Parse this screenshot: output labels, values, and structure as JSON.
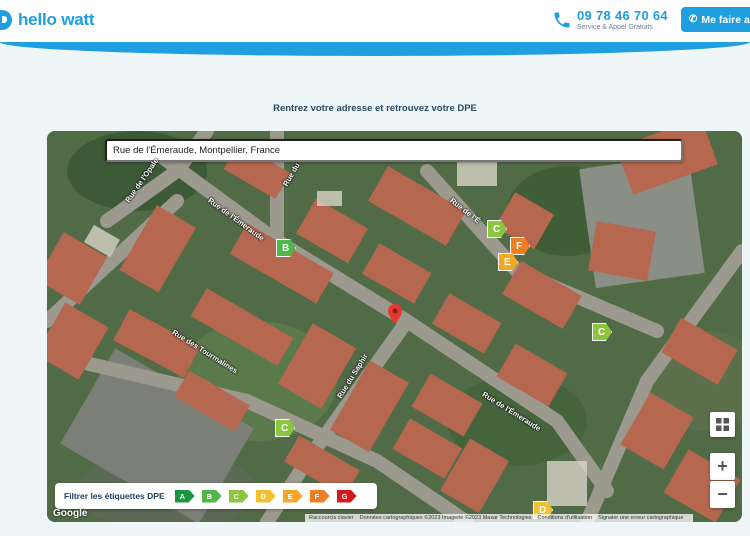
{
  "header": {
    "brand": "hello watt",
    "phone_number": "09 78 46 70 64",
    "phone_sub": "Service & Appel Gratuits",
    "cta_label": "Me faire ap"
  },
  "page": {
    "subtitle": "Rentrez votre adresse et retrouvez votre DPE"
  },
  "map": {
    "search_value": "Rue de l'Émeraude, Montpellier, France",
    "road_labels": [
      "Rue de l'Opale",
      "Rue de l'Émeraude",
      "Rue des Tourmalines",
      "Rue du Saphir",
      "Rue de l'Émeraude",
      "Rue de l'É",
      "Rue du"
    ],
    "pins": [
      "B",
      "C",
      "F",
      "E",
      "C",
      "C",
      "D"
    ],
    "filter_label": "Filtrer les étiquettes DPE",
    "filter_chips": [
      "A",
      "B",
      "C",
      "D",
      "E",
      "F",
      "G"
    ],
    "zoom_in": "+",
    "zoom_out": "−",
    "google": "Google",
    "attribution": [
      "Raccourcis clavier",
      "Données cartographiques ©2023 Imagerie ©2023 Maxar Technologies",
      "Conditions d'utilisation",
      "Signaler une erreur cartographique"
    ]
  },
  "colors": {
    "brand": "#1f9ee0",
    "A": "#1a9641",
    "B": "#52b64a",
    "C": "#8cc63f",
    "D": "#f2c12e",
    "E": "#f5a623",
    "F": "#ef7d22",
    "G": "#d7191c"
  }
}
